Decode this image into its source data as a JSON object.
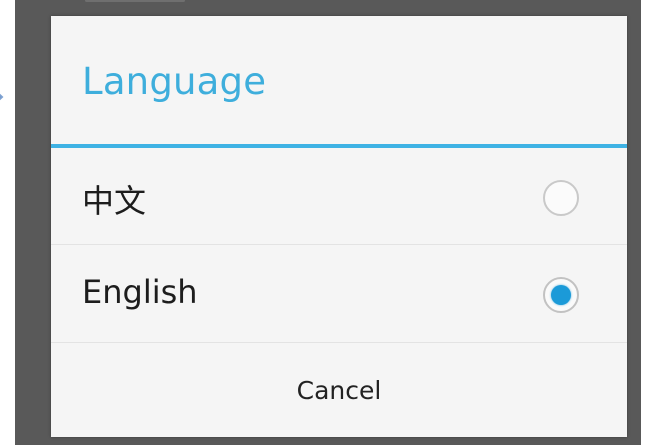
{
  "dialog": {
    "title": "Language",
    "options": [
      {
        "label": "中文",
        "selected": false
      },
      {
        "label": "English",
        "selected": true
      }
    ],
    "cancel_label": "Cancel"
  },
  "colors": {
    "accent": "#3eaedc",
    "divider": "#3eb2e4",
    "radio_checked": "#1b9ad8",
    "scrim": "#595959",
    "dialog_background": "#f5f5f5"
  },
  "icons": {
    "left_edge": "arrow-right-icon",
    "radio_unchecked": "radio-unchecked-icon",
    "radio_checked": "radio-checked-icon"
  }
}
